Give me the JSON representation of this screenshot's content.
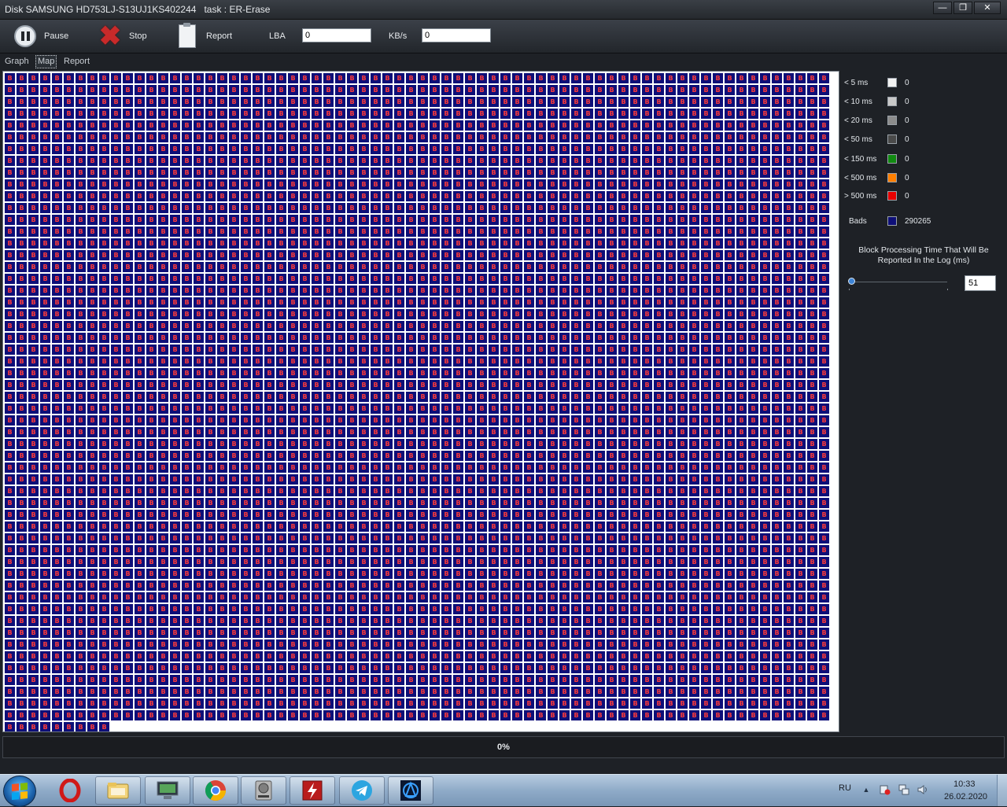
{
  "window": {
    "title": "Disk SAMSUNG HD753LJ-S13UJ1KS402244   task : ER-Erase"
  },
  "toolbar": {
    "pause_label": "Pause",
    "stop_label": "Stop",
    "report_label": "Report",
    "lba_label": "LBA",
    "lba_value": "0",
    "kbs_label": "KB/s",
    "kbs_value": "0"
  },
  "tabs": [
    {
      "label": "Graph",
      "active": false
    },
    {
      "label": "Map",
      "active": true
    },
    {
      "label": "Report",
      "active": false
    }
  ],
  "map": {
    "cell_glyph": "B",
    "cell_color": "#0e0f78",
    "glyph_color": "#ff3b3b",
    "columns": 70,
    "full_rows": 55,
    "last_row_cells": 9
  },
  "legend": {
    "items": [
      {
        "label": "< 5 ms",
        "color": "#f2f2f2",
        "count": "0"
      },
      {
        "label": "< 10 ms",
        "color": "#c8c8c8",
        "count": "0"
      },
      {
        "label": "< 20 ms",
        "color": "#8c8c8c",
        "count": "0"
      },
      {
        "label": "< 50 ms",
        "color": "#4a4a4a",
        "count": "0"
      },
      {
        "label": "< 150 ms",
        "color": "#118a11",
        "count": "0"
      },
      {
        "label": "< 500 ms",
        "color": "#ff7f00",
        "count": "0"
      },
      {
        "label": "> 500 ms",
        "color": "#e80000",
        "count": "0"
      }
    ],
    "bads": {
      "label": "Bads",
      "color": "#0e0f78",
      "count": "290265"
    },
    "block_time_text": "Block Processing Time That Will Be Reported In the Log (ms)",
    "block_time_value": "51",
    "slider_position": 0
  },
  "progress": {
    "percent_label": "0%",
    "value": 0
  },
  "taskbar": {
    "apps": [
      {
        "name": "opera-icon"
      },
      {
        "name": "file-explorer-icon"
      },
      {
        "name": "monitor-app-icon"
      },
      {
        "name": "chrome-icon"
      },
      {
        "name": "hdd-tool-icon"
      },
      {
        "name": "flash-app-icon"
      },
      {
        "name": "telegram-icon"
      },
      {
        "name": "vpn-app-icon"
      }
    ],
    "language": "RU",
    "time": "10:33",
    "date": "26.02.2020"
  }
}
